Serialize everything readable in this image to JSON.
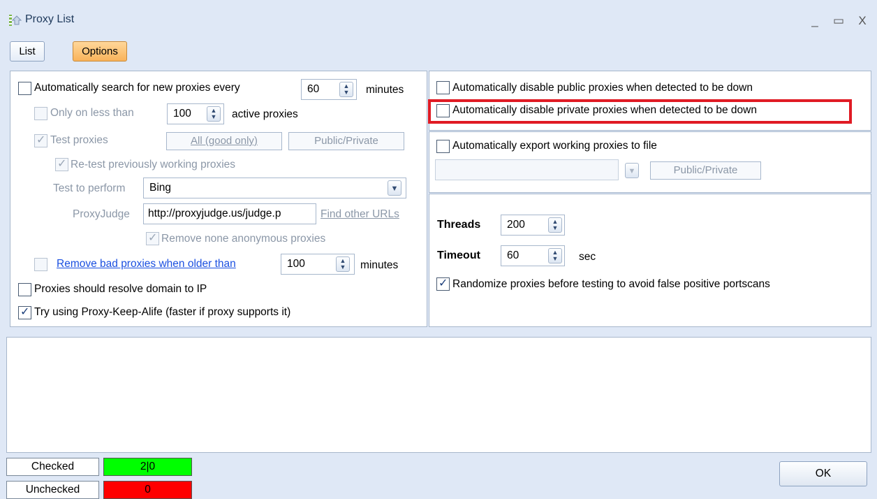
{
  "window": {
    "title": "Proxy List",
    "controls": {
      "minimize": "_",
      "maximize": "▭",
      "close": "X"
    }
  },
  "tabs": [
    {
      "label": "List",
      "active": false
    },
    {
      "label": "Options",
      "active": true
    }
  ],
  "left": {
    "auto_search": {
      "label": "Automatically search for new proxies every",
      "checked": false,
      "value": "60",
      "unit": "minutes"
    },
    "only_less": {
      "label": "Only on less than",
      "checked": false,
      "value": "100",
      "unit": "active proxies"
    },
    "test_proxies": {
      "label": "Test proxies",
      "checked": true,
      "btn_all": "All (good only)",
      "btn_public": "Public/Private"
    },
    "retest": {
      "label": "Re-test previously working proxies",
      "checked": true
    },
    "test_to_perform": {
      "label": "Test to perform",
      "value": "Bing"
    },
    "proxyjudge": {
      "label": "ProxyJudge",
      "value": "http://proxyjudge.us/judge.p",
      "link": "Find other URLs"
    },
    "remove_none_anon": {
      "label": "Remove none anonymous proxies",
      "checked": true
    },
    "remove_bad": {
      "label": "Remove bad proxies when older than",
      "checked": false,
      "value": "100",
      "unit": "minutes"
    },
    "resolve_domain": {
      "label": "Proxies should resolve domain to IP",
      "checked": false
    },
    "keep_alive": {
      "label": "Try using Proxy-Keep-Alife (faster if proxy supports it)",
      "checked": true
    }
  },
  "right": {
    "disable_public": {
      "label": "Automatically disable public proxies when detected to be down",
      "checked": false
    },
    "disable_private": {
      "label": "Automatically disable private proxies when detected to be down",
      "checked": false
    },
    "export": {
      "label": "Automatically export working proxies to file",
      "checked": false,
      "path": "",
      "btn": "Public/Private"
    },
    "threads": {
      "label": "Threads",
      "value": "200"
    },
    "timeout": {
      "label": "Timeout",
      "value": "60",
      "unit": "sec"
    },
    "randomize": {
      "label": "Randomize proxies before testing to avoid false positive portscans",
      "checked": true
    }
  },
  "status": {
    "checked": {
      "label": "Checked",
      "value": "2|0",
      "color": "#00ff00"
    },
    "unchecked": {
      "label": "Unchecked",
      "value": "0",
      "color": "#ff0000"
    }
  },
  "ok_label": "OK",
  "icons": [
    "app-icon",
    "spin-icon",
    "dropdown-arrow-icon",
    "check-icon"
  ]
}
